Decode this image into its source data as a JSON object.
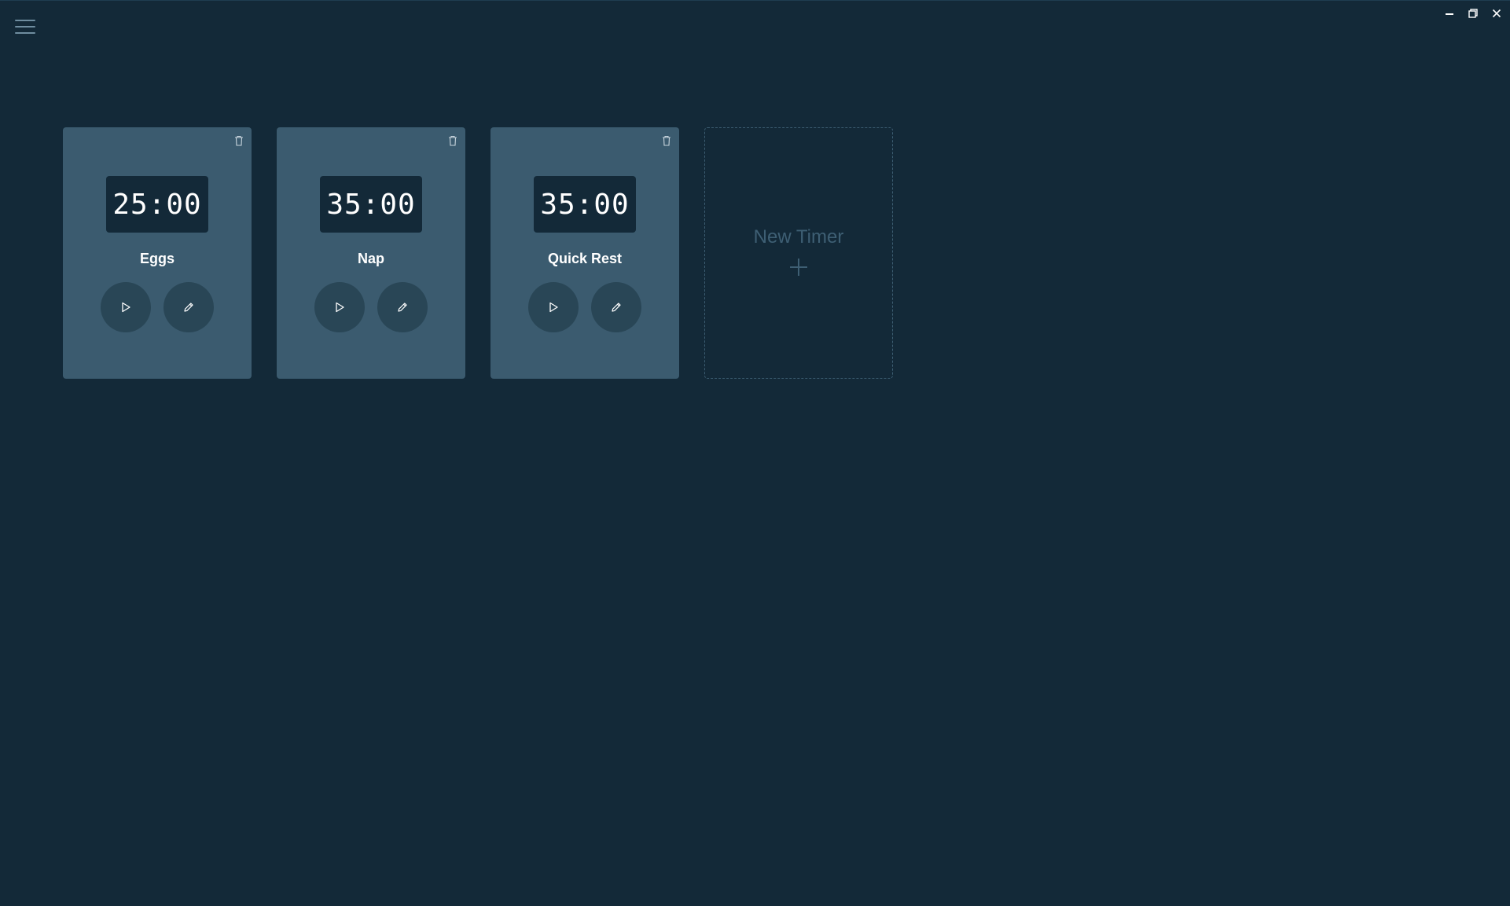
{
  "window": {
    "controls": {
      "minimize_icon": "minimize-icon",
      "restore_icon": "restore-icon",
      "close_icon": "close-icon"
    }
  },
  "menu": {
    "icon": "hamburger-menu-icon"
  },
  "timers": [
    {
      "time": "25:00",
      "name": "Eggs"
    },
    {
      "time": "35:00",
      "name": "Nap"
    },
    {
      "time": "35:00",
      "name": "Quick Rest"
    }
  ],
  "new_timer": {
    "label": "New Timer",
    "icon": "plus-icon"
  },
  "colors": {
    "background": "#132938",
    "card": "#3b5b6f",
    "action_button": "#294656",
    "text": "#ffffff",
    "muted": "#3e5f74"
  }
}
